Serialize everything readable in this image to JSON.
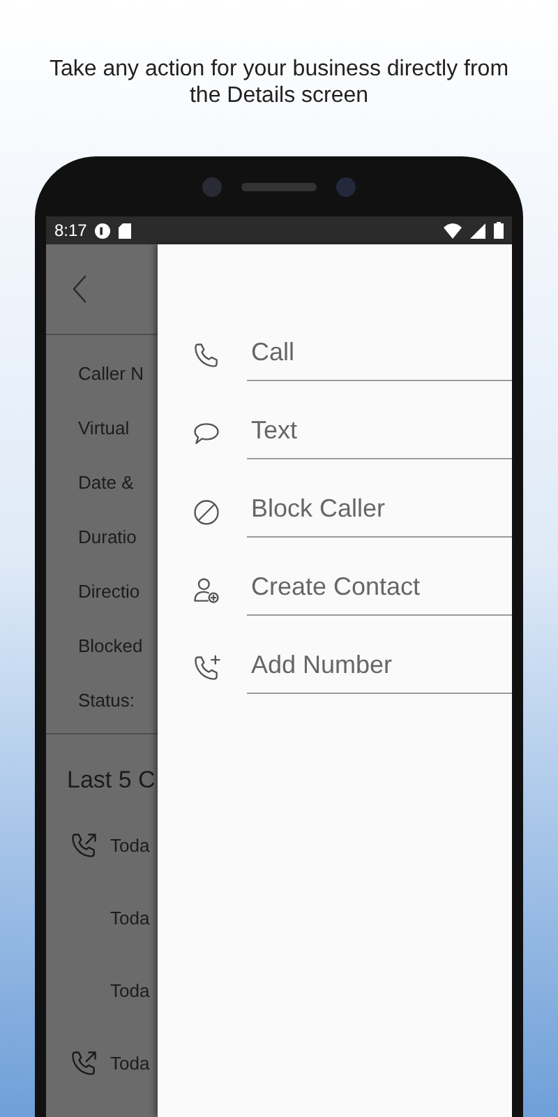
{
  "headline": "Take any action for your business directly from the Details screen",
  "status_bar": {
    "time": "8:17"
  },
  "details": {
    "fields": [
      "Caller N",
      "Virtual",
      "Date &",
      "Duratio",
      "Directio",
      "Blocked",
      "Status:"
    ],
    "section_title": "Last 5 C",
    "calls": [
      {
        "text": "Toda",
        "kind": "outgoing"
      },
      {
        "text": "Toda",
        "kind": "plain"
      },
      {
        "text": "Toda",
        "kind": "plain"
      },
      {
        "text": "Toda",
        "kind": "outgoing"
      }
    ]
  },
  "menu": {
    "items": [
      {
        "label": "Call",
        "kind": "call"
      },
      {
        "label": "Text",
        "kind": "text"
      },
      {
        "label": "Block Caller",
        "kind": "block"
      },
      {
        "label": "Create Contact",
        "kind": "contact"
      },
      {
        "label": "Add Number",
        "kind": "add-number"
      }
    ]
  }
}
